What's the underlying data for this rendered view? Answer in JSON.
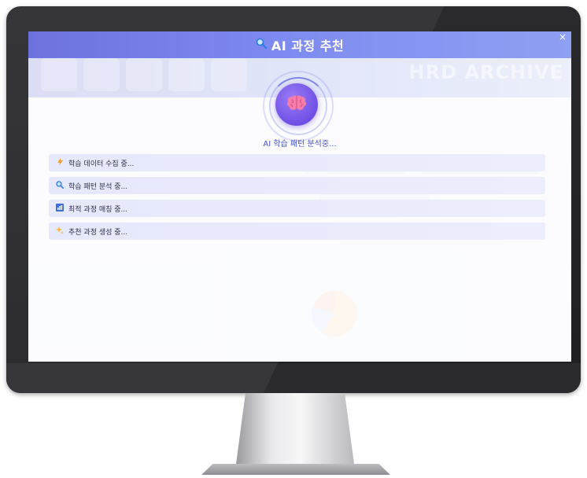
{
  "modal": {
    "title": "AI 과정 추천",
    "title_icon": "magnifier-icon",
    "close_label": "×",
    "status_text": "AI 학습 패턴 분석중...",
    "steps": [
      {
        "icon": "lightning-icon",
        "label": "학습 데이터 수집 중..."
      },
      {
        "icon": "magnifier-icon",
        "label": "학습 패턴 분석 중..."
      },
      {
        "icon": "bar-chart-icon",
        "label": "최적 과정 매칭 중..."
      },
      {
        "icon": "sparkle-icon",
        "label": "추천 과정 생성 중..."
      }
    ]
  },
  "colors": {
    "header_gradient_start": "#6e72de",
    "header_gradient_end": "#8fa0f3",
    "brain_circle": "#6f4fe6",
    "status_text": "#4a55c8",
    "step_background": "#e6e8fb"
  }
}
